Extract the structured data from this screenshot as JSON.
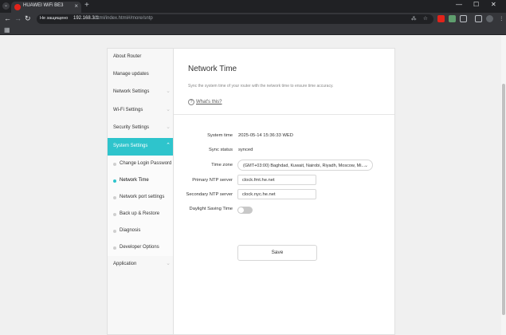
{
  "browser": {
    "tab_title": "HUAWEI WiFi BE3",
    "tab_close": "×",
    "new_tab": "+",
    "security_label": "Не защищено",
    "url_host": "192.168.3.1",
    "url_path": "/html/index.html#/more/sntp",
    "window_controls": {
      "minimize": "—",
      "maximize": "☐",
      "close": "✕"
    },
    "nav": {
      "back": "←",
      "forward": "→",
      "reload": "↻"
    }
  },
  "sidebar": {
    "items": [
      {
        "label": "About Router",
        "chevron": ""
      },
      {
        "label": "Manage updates",
        "chevron": ""
      },
      {
        "label": "Network Settings",
        "chevron": "⌄"
      },
      {
        "label": "Wi-Fi Settings",
        "chevron": "⌄"
      },
      {
        "label": "Security Settings",
        "chevron": "⌄"
      },
      {
        "label": "System Settings",
        "chevron": "⌃",
        "active": true
      }
    ],
    "sub_items": [
      {
        "label": "Change Login Password"
      },
      {
        "label": "Network Time",
        "active": true
      },
      {
        "label": "Network port settings"
      },
      {
        "label": "Back up & Restore"
      },
      {
        "label": "Diagnosis"
      },
      {
        "label": "Developer Options"
      }
    ],
    "after": {
      "label": "Application",
      "chevron": "⌄"
    }
  },
  "main": {
    "title": "Network Time",
    "description": "Sync the system time of your router with the network time to ensure time accuracy.",
    "help_link": "What's this?",
    "help_icon": "?",
    "fields": {
      "system_time_label": "System time",
      "system_time_value": "2025-05-14 15:36:33 WED",
      "sync_status_label": "Sync status",
      "sync_status_value": "synced",
      "time_zone_label": "Time zone",
      "time_zone_value": "(GMT+03:00) Baghdad, Kuwait, Nairobi, Riyadh, Moscow, Mi...",
      "primary_ntp_label": "Primary NTP server",
      "primary_ntp_value": "clock.fmt.he.net",
      "secondary_ntp_label": "Secondary NTP server",
      "secondary_ntp_value": "clock.nyc.he.net",
      "dst_label": "Daylight Saving Time",
      "dst_enabled": false
    },
    "save_label": "Save"
  },
  "colors": {
    "accent": "#2ec4cc",
    "brand_red": "#e2231a"
  }
}
